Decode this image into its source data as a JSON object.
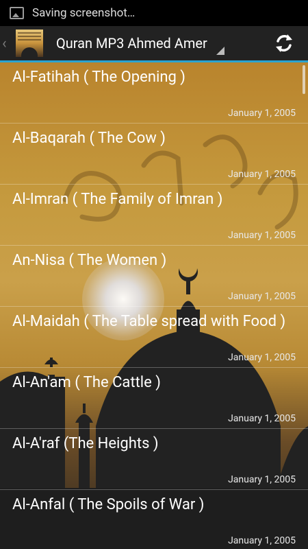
{
  "status_bar": {
    "text": "Saving screenshot…"
  },
  "action_bar": {
    "title": "Quran MP3 Ahmed Amer"
  },
  "surahs": [
    {
      "title": "Al-Fatihah ( The Opening )",
      "date": "January 1, 2005"
    },
    {
      "title": "Al-Baqarah ( The Cow )",
      "date": "January 1, 2005"
    },
    {
      "title": "Al-Imran ( The Family of Imran )",
      "date": "January 1, 2005"
    },
    {
      "title": "An-Nisa ( The Women )",
      "date": "January 1, 2005"
    },
    {
      "title": "Al-Maidah ( The Table spread with Food )",
      "date": "January 1, 2005"
    },
    {
      "title": "Al-An'am ( The Cattle )",
      "date": "January 1, 2005"
    },
    {
      "title": "Al-A'raf (The Heights )",
      "date": "January 1, 2005"
    },
    {
      "title": "Al-Anfal ( The Spoils of War )",
      "date": "January 1, 2005"
    }
  ],
  "colors": {
    "accent": "#2aa3d0",
    "action_bar": "#222222",
    "status_bar": "#000000"
  }
}
